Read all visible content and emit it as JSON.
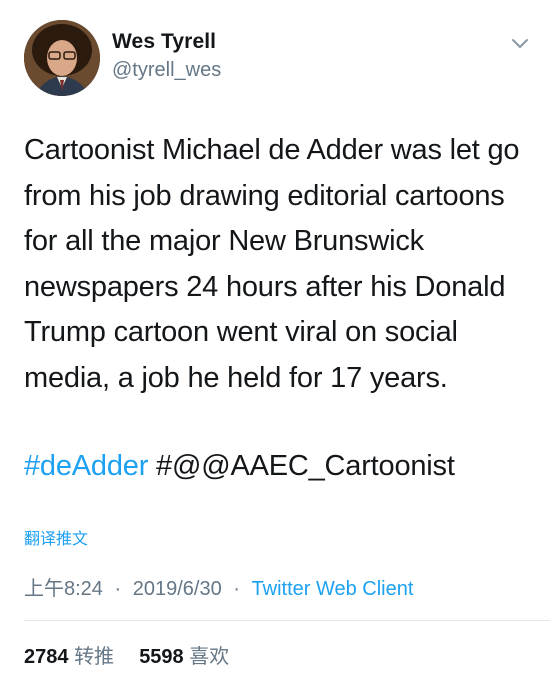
{
  "author": {
    "display_name": "Wes Tyrell",
    "handle": "@tyrell_wes"
  },
  "tweet": {
    "text": "Cartoonist Michael de Adder was let go from his job drawing editorial cartoons for all the major New Brunswick newspapers 24 hours after his Donald Trump cartoon went viral on social media, a job he held for 17 years.",
    "hashtag": "#deAdder",
    "mention_text": "#@@AAEC_Cartoonist",
    "translate_label": "翻译推文"
  },
  "meta": {
    "time": "上午8:24",
    "separator": "·",
    "date": "2019/6/30",
    "client": "Twitter Web Client"
  },
  "stats": {
    "retweet_count": "2784",
    "retweet_label": "转推",
    "like_count": "5598",
    "like_label": "喜欢"
  },
  "colors": {
    "accent": "#1da1f2",
    "secondary_text": "#657786",
    "primary_text": "#14171a"
  },
  "icons": {
    "chevron": "chevron-down-icon"
  }
}
